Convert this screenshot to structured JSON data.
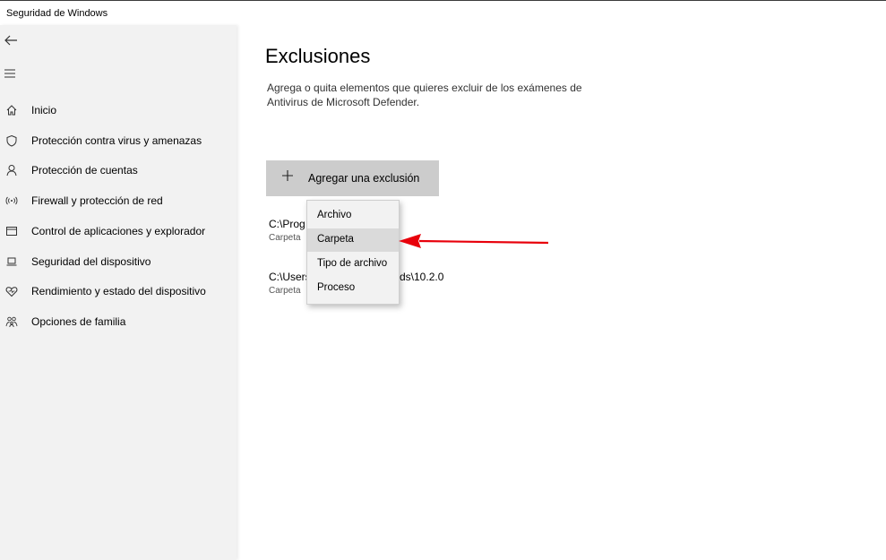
{
  "window": {
    "title": "Seguridad de Windows"
  },
  "sidebar": {
    "back_icon": "back-arrow-icon",
    "menu_icon": "hamburger-menu-icon",
    "items": [
      {
        "label": "Inicio",
        "icon": "home-icon"
      },
      {
        "label": "Protección contra virus y amenazas",
        "icon": "shield-icon"
      },
      {
        "label": "Protección de cuentas",
        "icon": "person-icon"
      },
      {
        "label": "Firewall y protección de red",
        "icon": "wifi-antenna-icon"
      },
      {
        "label": "Control de aplicaciones y explorador",
        "icon": "browser-window-icon"
      },
      {
        "label": "Seguridad del dispositivo",
        "icon": "laptop-icon"
      },
      {
        "label": "Rendimiento y estado del dispositivo",
        "icon": "heart-icon"
      },
      {
        "label": "Opciones de familia",
        "icon": "family-icon"
      }
    ]
  },
  "main": {
    "title": "Exclusiones",
    "description": "Agrega o quita elementos que quieres excluir de los exámenes de Antivirus de Microsoft Defender.",
    "add_button": {
      "label": "Agregar una exclusión",
      "icon": "plus-icon"
    },
    "exclusions": [
      {
        "path": "C:\\Prog",
        "type": "Carpeta"
      },
      {
        "path": "C:\\Users",
        "path_tail": "ds\\10.2.0",
        "type": "Carpeta"
      }
    ]
  },
  "dropdown": {
    "items": [
      {
        "label": "Archivo",
        "selected": false
      },
      {
        "label": "Carpeta",
        "selected": true
      },
      {
        "label": "Tipo de archivo",
        "selected": false
      },
      {
        "label": "Proceso",
        "selected": false
      }
    ]
  },
  "colors": {
    "sidebar_bg": "#f2f2f2",
    "button_bg": "#cccccc",
    "annotation_arrow": "#e8000b"
  }
}
